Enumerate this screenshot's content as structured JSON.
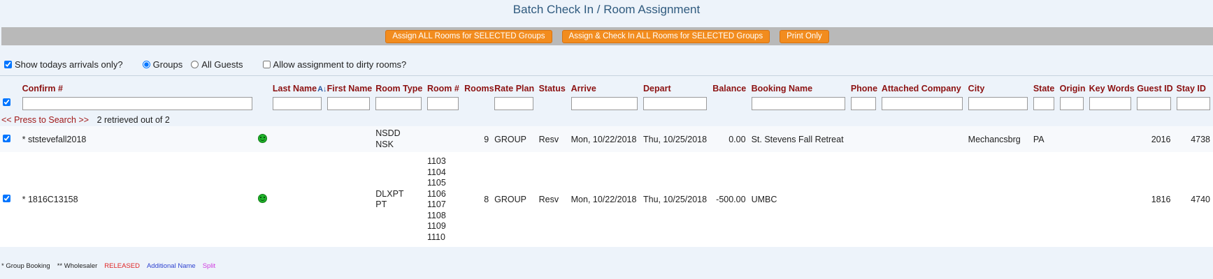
{
  "title": "Batch Check In / Room Assignment",
  "toolbar": {
    "assign_all": "Assign ALL Rooms for SELECTED Groups",
    "assign_checkin": "Assign & Check In ALL Rooms for SELECTED Groups",
    "print_only": "Print Only"
  },
  "options": {
    "todays_arrivals": "Show todays arrivals only?",
    "groups": "Groups",
    "all_guests": "All Guests",
    "allow_dirty": "Allow assignment to dirty rooms?"
  },
  "columns": {
    "confirm": "Confirm #",
    "last_name": "Last Name",
    "first_name": "First Name",
    "room_type": "Room Type",
    "room_num": "Room #",
    "rooms": "Rooms",
    "rate_plan": "Rate Plan",
    "status": "Status",
    "arrive": "Arrive",
    "depart": "Depart",
    "balance": "Balance",
    "booking_name": "Booking Name",
    "phone": "Phone",
    "attached_company": "Attached Company",
    "city": "City",
    "state": "State",
    "origin": "Origin",
    "key_words": "Key Words",
    "guest_id": "Guest ID",
    "stay_id": "Stay ID"
  },
  "search": {
    "press": "<< Press to Search >>",
    "retrieved": "2 retrieved out of 2"
  },
  "rows": [
    {
      "confirm": "* ststevefall2018",
      "room_type": [
        "NSDD",
        "NSK"
      ],
      "room_nums": [],
      "rooms": "9",
      "rate_plan": "GROUP",
      "status": "Resv",
      "arrive": "Mon, 10/22/2018",
      "depart": "Thu, 10/25/2018",
      "balance": "0.00",
      "booking_name": "St. Stevens Fall Retreat",
      "city": "Mechancsbrg",
      "state": "PA",
      "guest_id": "2016",
      "stay_id": "4738"
    },
    {
      "confirm": "* 1816C13158",
      "room_type": [
        "DLXPT",
        "PT"
      ],
      "room_nums": [
        "1103",
        "1104",
        "1105",
        "1106",
        "1107",
        "1108",
        "1109",
        "1110"
      ],
      "rooms": "8",
      "rate_plan": "GROUP",
      "status": "Resv",
      "arrive": "Mon, 10/22/2018",
      "depart": "Thu, 10/25/2018",
      "balance": "-500.00",
      "booking_name": "UMBC",
      "city": "",
      "state": "",
      "guest_id": "1816",
      "stay_id": "4740"
    }
  ],
  "legend": {
    "group": "* Group Booking",
    "wholesaler": "** Wholesaler",
    "released": "RELEASED",
    "additional": "Additional Name",
    "split": "Split"
  },
  "colors": {
    "button": "#f28c1e",
    "header_text": "#8c1212",
    "title": "#2f5a7e",
    "smiley": "#1fb32a"
  }
}
